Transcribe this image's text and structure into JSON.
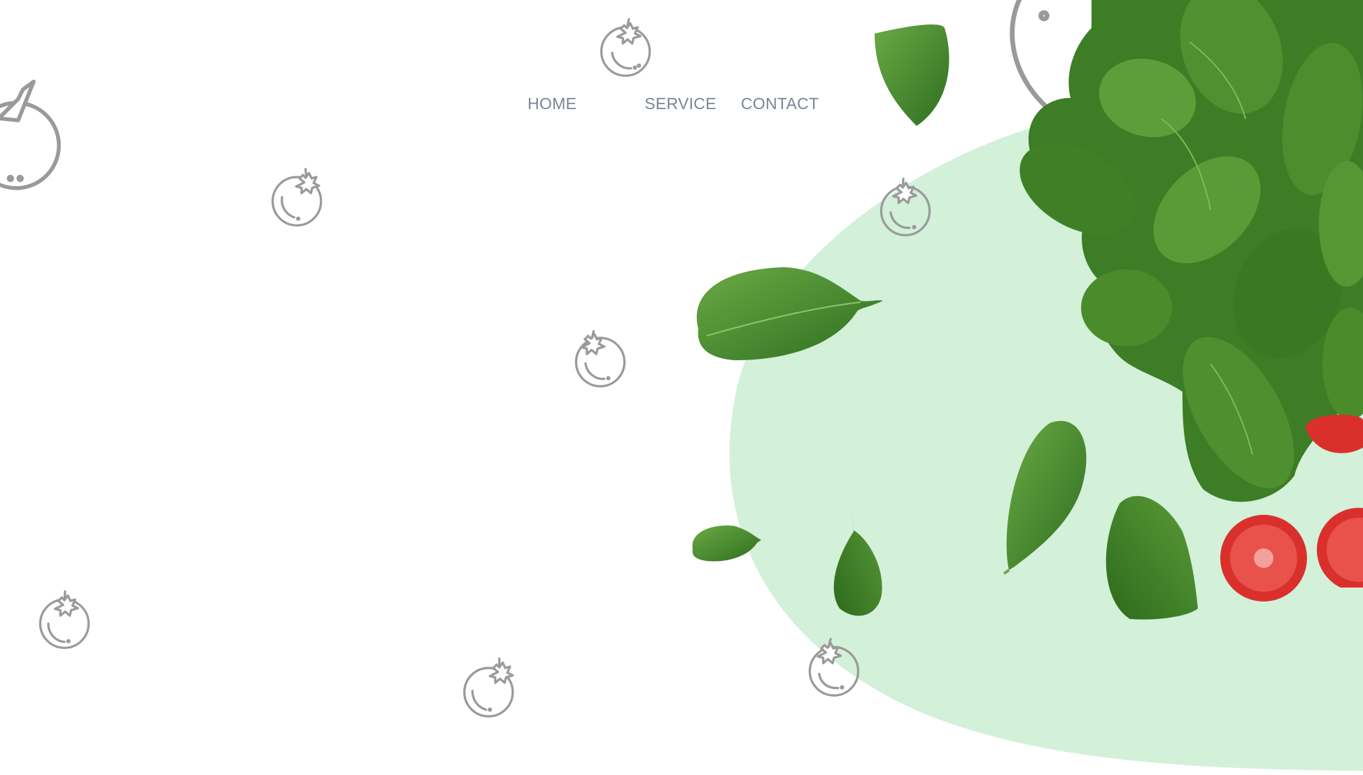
{
  "nav": {
    "items": [
      {
        "label": "HOME"
      },
      {
        "label": "SERVICE"
      },
      {
        "label": "CONTACT"
      }
    ]
  },
  "colors": {
    "background": "#ffffff",
    "blob": "#d3f0d9",
    "nav_text": "#7a8594",
    "icon_stroke": "#9a9a9a",
    "leaf_dark": "#2f6e1f",
    "leaf_mid": "#4a8c2e",
    "leaf_light": "#6aaa45",
    "tomato_red": "#d9302c"
  },
  "icons": [
    "tomato-outline-icon"
  ],
  "images": [
    "basil-leaves-illustration",
    "cherry-tomato-slices-illustration"
  ]
}
